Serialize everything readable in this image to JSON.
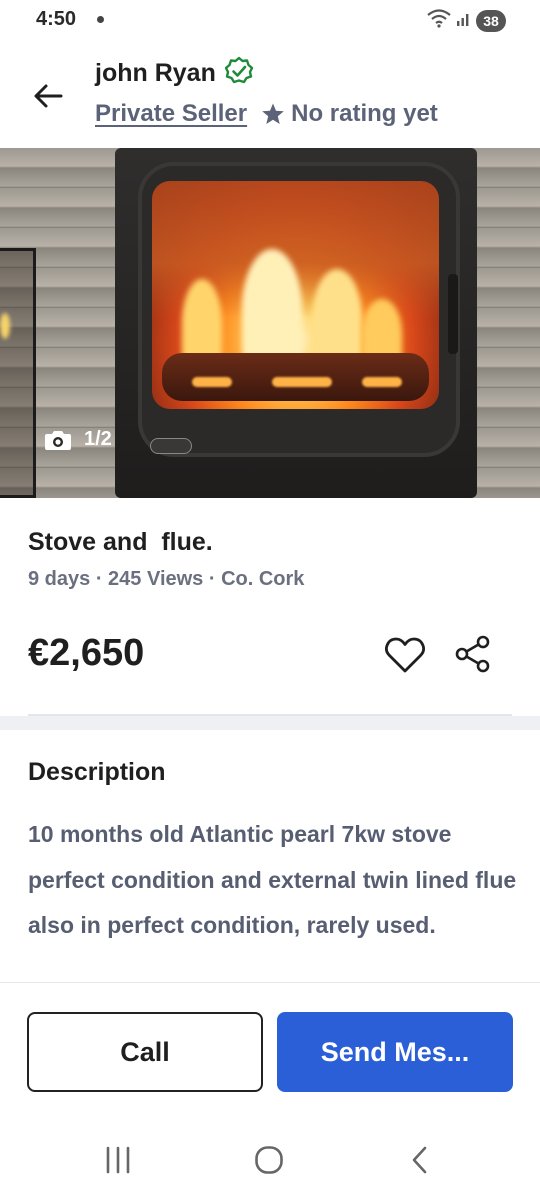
{
  "status_bar": {
    "time": "4:50",
    "battery": "38",
    "icons": [
      "wifi-icon",
      "signal-icon",
      "battery-icon"
    ]
  },
  "header": {
    "back_icon": "arrow-left-icon",
    "seller_name": "john Ryan",
    "verified_icon": "verified-badge-icon",
    "seller_type": "Private Seller",
    "rating_icon": "star-icon",
    "rating_text": "No rating yet"
  },
  "gallery": {
    "counter": "1/2",
    "camera_icon": "camera-icon"
  },
  "listing": {
    "title": "Stove and  flue.",
    "meta": "9 days · 245 Views · Co. Cork",
    "price": "€2,650",
    "favourite_icon": "heart-icon",
    "share_icon": "share-icon"
  },
  "description": {
    "heading": "Description",
    "body": "10 months old Atlantic pearl 7kw stove perfect condition and external twin lined flue also in  perfect condition, rarely used."
  },
  "actions": {
    "call_label": "Call",
    "send_label": "Send Mes..."
  },
  "nav_bar": {
    "icons": [
      "recents-icon",
      "home-icon",
      "back-icon"
    ]
  },
  "colors": {
    "accent": "#2a5fd8",
    "verified": "#1e8a3a",
    "muted_text": "#5c6378"
  }
}
